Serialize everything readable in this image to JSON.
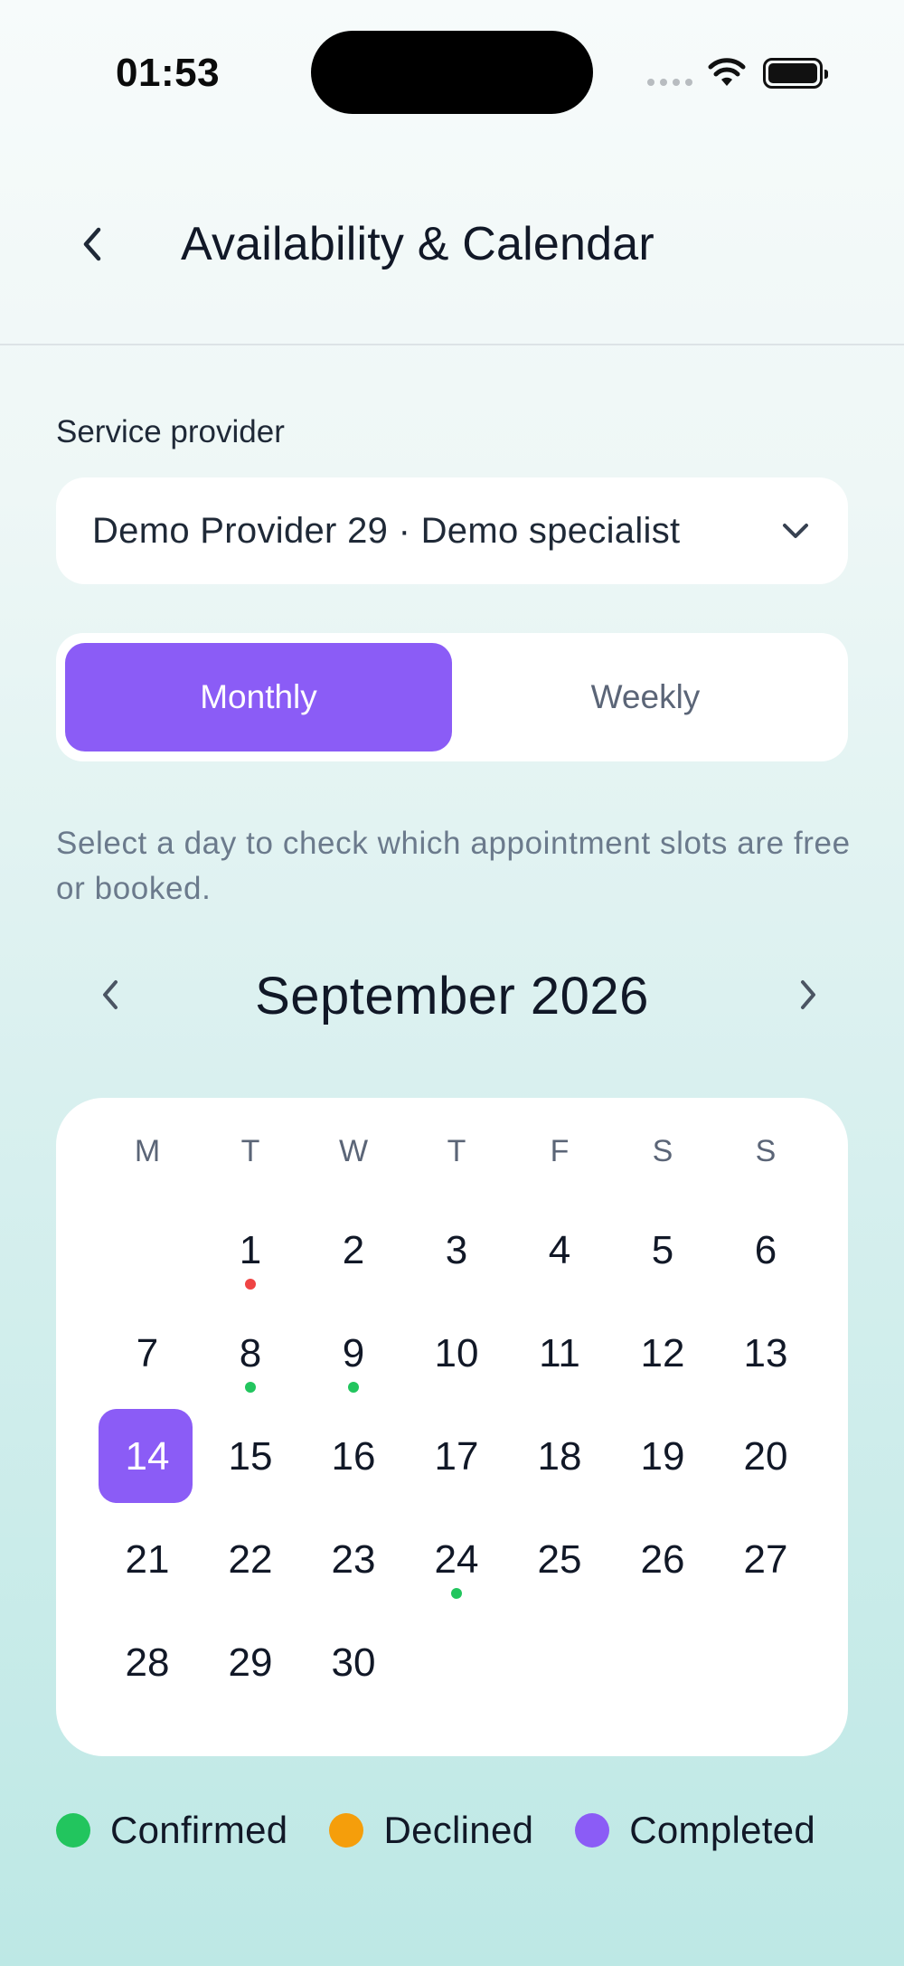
{
  "status_bar": {
    "time": "01:53"
  },
  "header": {
    "title": "Availability & Calendar"
  },
  "provider": {
    "label": "Service provider",
    "value": "Demo Provider 29 · Demo specialist"
  },
  "view_toggle": {
    "monthly": "Monthly",
    "weekly": "Weekly",
    "selected": "Monthly"
  },
  "hint": "Select a day to check which appointment slots are free or booked.",
  "calendar": {
    "month_title": "September 2026",
    "weekdays": [
      "M",
      "T",
      "W",
      "T",
      "F",
      "S",
      "S"
    ],
    "first_weekday_offset": 1,
    "days_in_month": 30,
    "selected_day": 14,
    "markers": [
      {
        "day": 1,
        "status": "declined-red"
      },
      {
        "day": 8,
        "status": "confirmed"
      },
      {
        "day": 9,
        "status": "confirmed"
      },
      {
        "day": 24,
        "status": "confirmed"
      }
    ]
  },
  "colors": {
    "accent": "#8b5cf6",
    "confirmed": "#22c55e",
    "declined": "#f59e0b",
    "completed": "#8b5cf6",
    "declined-red": "#ef4444"
  },
  "legend": [
    {
      "label": "Confirmed",
      "color": "#22c55e"
    },
    {
      "label": "Declined",
      "color": "#f59e0b"
    },
    {
      "label": "Completed",
      "color": "#8b5cf6"
    }
  ]
}
